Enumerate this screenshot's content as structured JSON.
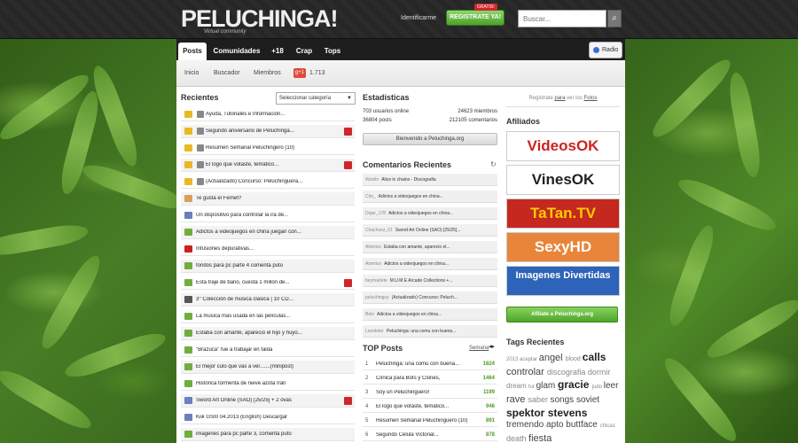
{
  "header": {
    "logo": "PELUCHINGA!",
    "logo_sub": "Virtual community",
    "identify_label": "Identificarme",
    "register_label": "REGISTRATE YA!",
    "register_badge": "GRATIS!",
    "search_placeholder": "Buscar..."
  },
  "nav": {
    "tabs": [
      "Posts",
      "Comunidades",
      "+18",
      "Crap",
      "Tops"
    ],
    "radio_label": "Radio"
  },
  "subnav": {
    "items": [
      "Inicio",
      "Buscador",
      "Miembros"
    ],
    "gplus": "g+1",
    "count": "1.713"
  },
  "recientes": {
    "title": "Recientes",
    "select_label": "Seleccionar categoría",
    "posts": [
      {
        "text": "Ayuda, Tutoriales e Información...",
        "icon": "#e8b923",
        "sub": true,
        "sticky": false
      },
      {
        "text": "Segundo aniversario de Peluchinga...",
        "icon": "#e8b923",
        "sub": true,
        "sticky": true
      },
      {
        "text": "Resumen Semanal Peluchingero (10)",
        "icon": "#e8b923",
        "sub": true,
        "sticky": false
      },
      {
        "text": "El logo que votaste, temático...",
        "icon": "#e8b923",
        "sub": true,
        "sticky": true
      },
      {
        "text": "(Actualizado) Concurso: Peluchinguera...",
        "icon": "#e8b923",
        "sub": true,
        "sticky": false
      },
      {
        "text": "Te gusta el Fernet?",
        "icon": "#d9a05b",
        "sub": false,
        "sticky": false
      },
      {
        "text": "Un dispositivo para controlar la ira de...",
        "icon": "#6a7fc0",
        "sub": false,
        "sticky": false
      },
      {
        "text": "Adictos a videojuegos en china juegan con...",
        "icon": "#6fae3d",
        "sub": false,
        "sticky": false
      },
      {
        "text": "Infusiones depurativas...",
        "icon": "#c8231f",
        "sub": false,
        "sticky": false
      },
      {
        "text": "fondos para pc parte 4 comenta puto",
        "icon": "#6fae3d",
        "sub": false,
        "sticky": false
      },
      {
        "text": "Esta traje de baño, cuesta 1 millón de...",
        "icon": "#6fae3d",
        "sub": false,
        "sticky": true
      },
      {
        "text": "3° Colección de música clásica | 10 CD...",
        "icon": "#555555",
        "sub": false,
        "sticky": false
      },
      {
        "text": "La musica mas usada en las películas...",
        "icon": "#6fae3d",
        "sub": false,
        "sticky": false
      },
      {
        "text": "Estaba con amante, aparecio el hijo y huyo...",
        "icon": "#6fae3d",
        "sub": false,
        "sticky": false
      },
      {
        "text": "\"Brazuca\" fue a trabajar en falda",
        "icon": "#6fae3d",
        "sub": false,
        "sticky": false
      },
      {
        "text": "El mejor culo que vas a ver.......(minipost)",
        "icon": "#6fae3d",
        "sub": false,
        "sticky": false
      },
      {
        "text": "Histórica tormenta de nieve azota Irán",
        "icon": "#6fae3d",
        "sub": false,
        "sticky": false
      },
      {
        "text": "Sword Art Online (SAO) [25/25] + 2 ovas",
        "icon": "#6a7fc0",
        "sub": false,
        "sticky": true
      },
      {
        "text": "Kiik GSIII 04.2013 (English) Descargar",
        "icon": "#6a7fc0",
        "sub": false,
        "sticky": false
      },
      {
        "text": "imagenes para pc parte 3, comenta puto",
        "icon": "#6fae3d",
        "sub": false,
        "sticky": false
      }
    ]
  },
  "stats": {
    "title": "Estadisticas",
    "online": "703 usuarios online",
    "members": "24623 miembros",
    "posts": "36804 posts",
    "comments": "212105 comentarios",
    "welcome": "Bienvenido a Peluchinga.org"
  },
  "comments": {
    "title": "Comentarios Recientes",
    "items": [
      {
        "user": "Woolin",
        "text": "Alice in chains - Discografia"
      },
      {
        "user": "Cim_",
        "text": "Adictos a videojuegos en china..."
      },
      {
        "user": "Dojer_178",
        "text": "Adictos a videojuegos en china..."
      },
      {
        "user": "Chachunz_01",
        "text": "Sword Art Online (SAO) [25/25]..."
      },
      {
        "user": "Atomico",
        "text": "Estaba con amante, aparecio el..."
      },
      {
        "user": "Atomico",
        "text": "Adictos a videojuegos en china..."
      },
      {
        "user": "beymarlete",
        "text": "M.U.M.E Arcade Collections +..."
      },
      {
        "user": "peluchinguy",
        "text": "(Actualizado) Concurso: Peluch..."
      },
      {
        "user": "Belo",
        "text": "Adictos a videojuegos en china..."
      },
      {
        "user": "Leonleter",
        "text": "Peluchinga: una comu con buena..."
      }
    ]
  },
  "top": {
    "title": "TOP Posts",
    "period": "Semana",
    "items": [
      {
        "n": "1",
        "t": "Peluchinga: una comu con buena...",
        "p": "1824"
      },
      {
        "n": "2",
        "t": "Clínica para Bots y Clones,",
        "p": "1464"
      },
      {
        "n": "3",
        "t": "Soy un Peluchinguero!",
        "p": "1199"
      },
      {
        "n": "4",
        "t": "El logo que votaste, temático...",
        "p": "946"
      },
      {
        "n": "5",
        "t": "Resumen Semanal Peluchinguero (10)",
        "p": "891"
      },
      {
        "n": "6",
        "t": "Segundo Célula Victorial...",
        "p": "878"
      }
    ]
  },
  "sidebar": {
    "login_text_1": "Registrate",
    "login_text_2": "para",
    "login_text_3": "ver los",
    "login_text_4": "Fotos",
    "afiliados_title": "Afiliados",
    "affiliates": [
      {
        "name": "VideosOK",
        "color": "#cc2222",
        "bg": "#ffffff"
      },
      {
        "name": "VinesOK",
        "color": "#222222",
        "bg": "#ffffff"
      },
      {
        "name": "TaTan.TV",
        "color": "#ffcc00",
        "bg": "#c4281e"
      },
      {
        "name": "SexyHD",
        "color": "#ffffff",
        "bg": "#e8853a"
      },
      {
        "name": "Imagenes Divertidas",
        "color": "#ffffff",
        "bg": "#2d63b8"
      }
    ],
    "affiliate_btn": "Afiliate a Peluchinga.org",
    "tags_title": "Tags Recientes",
    "tags": [
      {
        "t": "2013",
        "s": 6
      },
      {
        "t": "aceptar",
        "s": 6
      },
      {
        "t": "angel",
        "s": 11
      },
      {
        "t": "blood",
        "s": 7
      },
      {
        "t": "calls",
        "s": 12
      },
      {
        "t": "controlar",
        "s": 11
      },
      {
        "t": "discografia",
        "s": 9
      },
      {
        "t": "dormir",
        "s": 9
      },
      {
        "t": "dream",
        "s": 8
      },
      {
        "t": "fur",
        "s": 6
      },
      {
        "t": "glam",
        "s": 10
      },
      {
        "t": "gracie",
        "s": 12
      },
      {
        "t": "judo",
        "s": 6
      },
      {
        "t": "leer",
        "s": 10
      },
      {
        "t": "rave",
        "s": 11
      },
      {
        "t": "saber",
        "s": 9
      },
      {
        "t": "songs",
        "s": 10
      },
      {
        "t": "soviet",
        "s": 10
      },
      {
        "t": "spektor",
        "s": 12
      },
      {
        "t": "stevens",
        "s": 12
      },
      {
        "t": "tremendo",
        "s": 10
      },
      {
        "t": "apto",
        "s": 10
      },
      {
        "t": "buttface",
        "s": 10
      },
      {
        "t": "chicas",
        "s": 6
      },
      {
        "t": "death",
        "s": 9
      },
      {
        "t": "fiesta",
        "s": 11
      }
    ]
  }
}
